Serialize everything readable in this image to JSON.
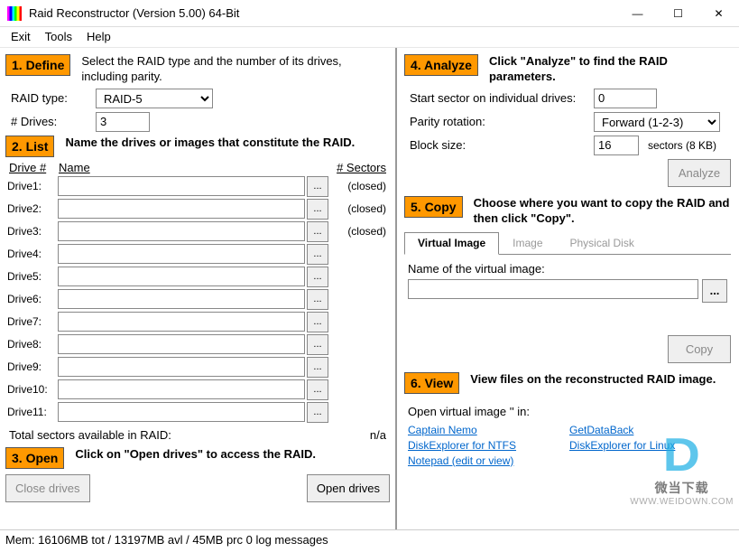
{
  "window": {
    "title": "Raid Reconstructor (Version 5.00) 64-Bit"
  },
  "menu": {
    "exit": "Exit",
    "tools": "Tools",
    "help": "Help"
  },
  "define": {
    "badge": "1. Define",
    "desc": "Select the RAID type and the number of its drives, including parity.",
    "raid_type_label": "RAID type:",
    "raid_type_value": "RAID-5",
    "drives_label": "# Drives:",
    "drives_value": "3"
  },
  "list": {
    "badge": "2. List",
    "desc": "Name the drives or images that constitute the RAID.",
    "col_drive": "Drive #",
    "col_name": "Name",
    "col_sectors": "# Sectors",
    "drives": [
      {
        "label": "Drive1:",
        "value": "",
        "status": "(closed)"
      },
      {
        "label": "Drive2:",
        "value": "",
        "status": "(closed)"
      },
      {
        "label": "Drive3:",
        "value": "",
        "status": "(closed)"
      },
      {
        "label": "Drive4:",
        "value": "",
        "status": ""
      },
      {
        "label": "Drive5:",
        "value": "",
        "status": ""
      },
      {
        "label": "Drive6:",
        "value": "",
        "status": ""
      },
      {
        "label": "Drive7:",
        "value": "",
        "status": ""
      },
      {
        "label": "Drive8:",
        "value": "",
        "status": ""
      },
      {
        "label": "Drive9:",
        "value": "",
        "status": ""
      },
      {
        "label": "Drive10:",
        "value": "",
        "status": ""
      },
      {
        "label": "Drive11:",
        "value": "",
        "status": ""
      }
    ],
    "total_label": "Total sectors available in RAID:",
    "total_value": "n/a"
  },
  "open": {
    "badge": "3. Open",
    "desc": "Click on \"Open drives\" to access the RAID.",
    "close_btn": "Close drives",
    "open_btn": "Open drives"
  },
  "analyze": {
    "badge": "4. Analyze",
    "desc": "Click \"Analyze\" to find the RAID parameters.",
    "start_sector_label": "Start sector on individual drives:",
    "start_sector_value": "0",
    "parity_label": "Parity rotation:",
    "parity_value": "Forward (1-2-3)",
    "block_label": "Block size:",
    "block_value": "16",
    "block_note": "sectors (8 KB)",
    "analyze_btn": "Analyze"
  },
  "copy": {
    "badge": "5. Copy",
    "desc": "Choose where you want to copy the RAID and then click \"Copy\".",
    "tab_virtual": "Virtual Image",
    "tab_image": "Image",
    "tab_physical": "Physical Disk",
    "name_label": "Name of the virtual image:",
    "name_value": "",
    "copy_btn": "Copy"
  },
  "view": {
    "badge": "6. View",
    "desc": "View files on the reconstructed RAID image.",
    "open_label": "Open virtual image '' in:",
    "links": {
      "nemo": "Captain Nemo",
      "de_ntfs": "DiskExplorer for NTFS",
      "notepad": "Notepad (edit or view)",
      "gdb": "GetDataBack",
      "de_linux": "DiskExplorer for Linux"
    }
  },
  "status": {
    "text": "Mem: 16106MB tot / 13197MB avl / 45MB prc  0 log messages"
  },
  "watermark": {
    "cn": "微当下载",
    "url": "WWW.WEIDOWN.COM"
  },
  "ellipsis": "..."
}
